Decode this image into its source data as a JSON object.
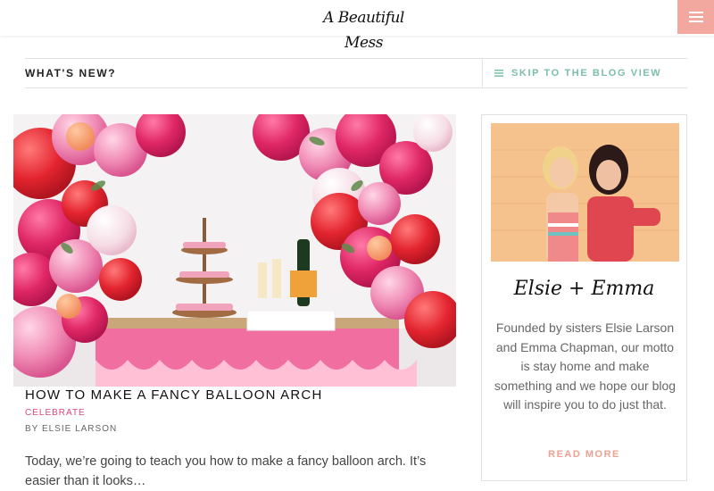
{
  "header": {
    "logo_text": "A Beautiful Mess",
    "menu_icon": "hamburger-icon",
    "accent_color": "#f2a89f"
  },
  "news_bar": {
    "title": "WHAT'S NEW?",
    "skip_label": "SKIP TO THE BLOG VIEW",
    "skip_icon": "list-icon",
    "skip_color": "#7bbfa6"
  },
  "featured_post": {
    "image_alt": "balloon arch over a pink dessert table",
    "title": "HOW TO MAKE A FANCY BALLOON ARCH",
    "category": "CELEBRATE",
    "author": "BY ELSIE LARSON",
    "excerpt": "Today, we’re going to teach you how to make a fancy balloon arch. It’s easier than it looks…",
    "category_color": "#e0457b"
  },
  "sidebar": {
    "signature": "Elsie + Emma",
    "about": "Founded by sisters Elsie Larson and Emma Chapman, our motto is stay home and make something and we hope our blog will inspire you to do just that.",
    "read_more": "READ MORE",
    "read_more_color": "#eea092"
  }
}
